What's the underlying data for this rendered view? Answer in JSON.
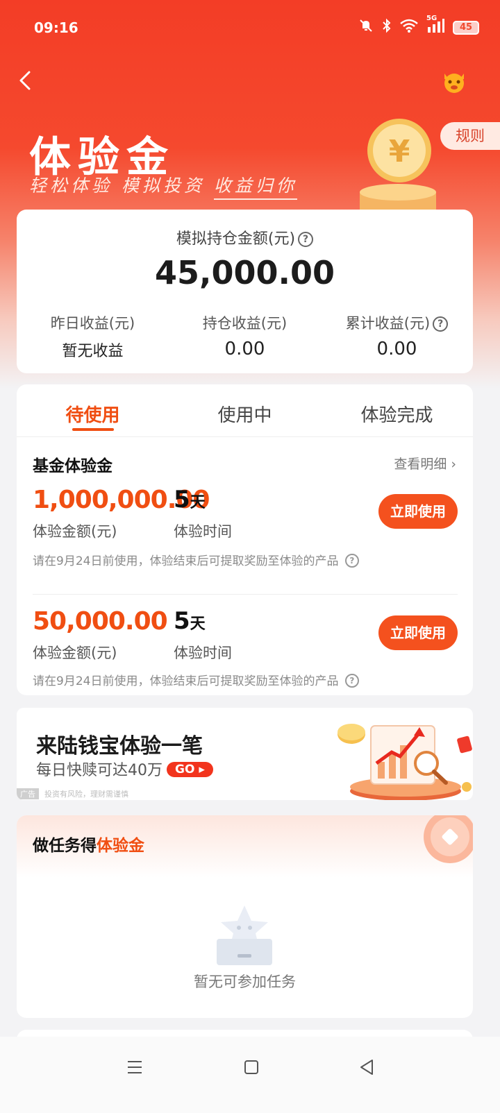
{
  "status_bar": {
    "time": "09:16",
    "network": "5G",
    "battery": "45"
  },
  "header": {
    "title": "体验金",
    "subtitle_part1": "轻松体验  模拟投资  ",
    "subtitle_part2": "收益归你",
    "rules_label": "规则"
  },
  "summary": {
    "label": "模拟持仓金额(元)",
    "amount": "45,000.00",
    "stats": [
      {
        "label": "昨日收益(元)",
        "value": "暂无收益"
      },
      {
        "label": "持仓收益(元)",
        "value": "0.00"
      },
      {
        "label": "累计收益(元)",
        "value": "0.00"
      }
    ]
  },
  "tabs": [
    {
      "label": "待使用",
      "active": true
    },
    {
      "label": "使用中",
      "active": false
    },
    {
      "label": "体验完成",
      "active": false
    }
  ],
  "fund_section": {
    "title": "基金体验金",
    "view_detail": "查看明细",
    "vouchers": [
      {
        "amount": "1,000,000.00",
        "amount_label": "体验金额(元)",
        "days": "5",
        "days_unit": "天",
        "days_label": "体验时间",
        "button": "立即使用",
        "note": "请在9月24日前使用，体验结束后可提取奖励至体验的产品"
      },
      {
        "amount": "50,000.00",
        "amount_label": "体验金额(元)",
        "days": "5",
        "days_unit": "天",
        "days_label": "体验时间",
        "button": "立即使用",
        "note": "请在9月24日前使用，体验结束后可提取奖励至体验的产品"
      }
    ]
  },
  "ad": {
    "title": "来陆钱宝体验一笔",
    "subtitle": "每日快赎可达40万",
    "go_label": "GO",
    "tag": "广告",
    "disclaimer": "投资有风险，理财需谨慎"
  },
  "tasks": {
    "title_part1": "做任务得",
    "title_part2": "体验金",
    "empty_text": "暂无可参加任务"
  },
  "colors": {
    "brand_red": "#f33d26",
    "accent_orange": "#f04e12",
    "button_orange": "#f4511e"
  }
}
